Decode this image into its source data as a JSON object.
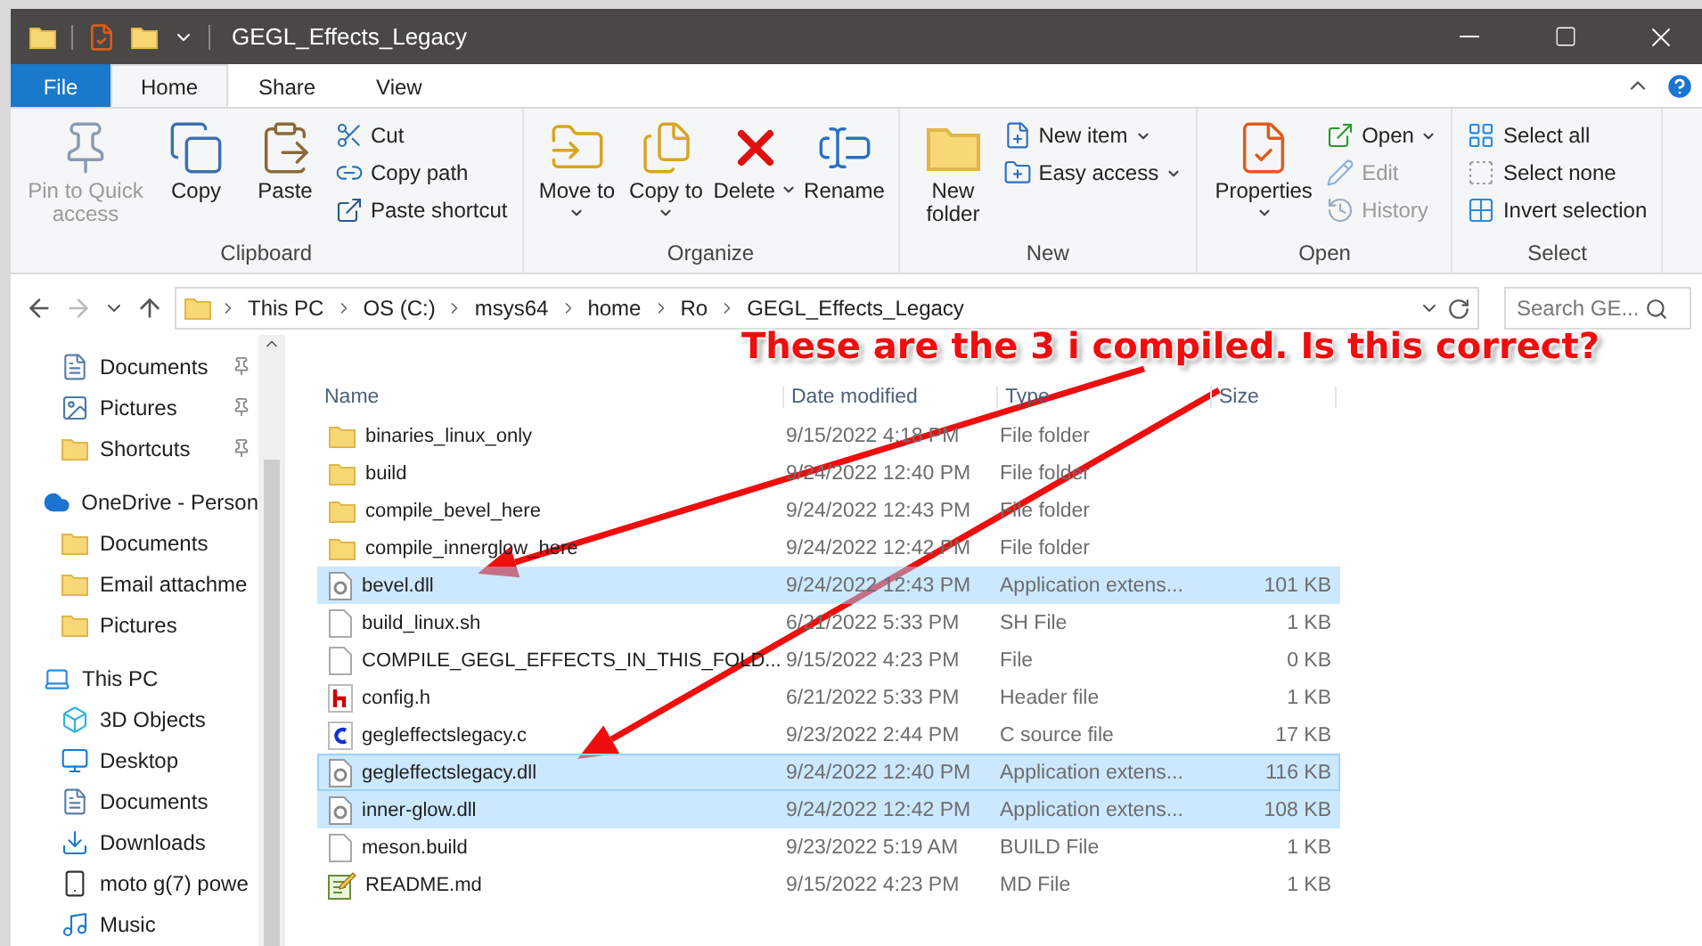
{
  "window": {
    "title": "GEGL_Effects_Legacy"
  },
  "ribbon_tabs": [
    {
      "label": "File",
      "kind": "file",
      "selected": false
    },
    {
      "label": "Home",
      "kind": "tab",
      "selected": true
    },
    {
      "label": "Share",
      "kind": "tab",
      "selected": false
    },
    {
      "label": "View",
      "kind": "tab",
      "selected": false
    }
  ],
  "ribbon": {
    "groups": [
      {
        "label": "Clipboard",
        "large": [
          {
            "label": "Pin to Quick access",
            "kind": "pin",
            "disabled": true,
            "dropdown": false
          },
          {
            "label": "Copy",
            "kind": "copy",
            "disabled": false,
            "dropdown": false
          },
          {
            "label": "Paste",
            "kind": "paste",
            "disabled": false,
            "dropdown": false
          }
        ],
        "small": [
          {
            "label": "Cut",
            "kind": "cut",
            "disabled": false,
            "dropdown": false
          },
          {
            "label": "Copy path",
            "kind": "path",
            "disabled": false,
            "dropdown": false
          },
          {
            "label": "Paste shortcut",
            "kind": "shortcut",
            "disabled": false,
            "dropdown": false
          }
        ]
      },
      {
        "label": "Organize",
        "large": [
          {
            "label": "Move to",
            "kind": "move",
            "disabled": false,
            "dropdown": true
          },
          {
            "label": "Copy to",
            "kind": "copyto",
            "disabled": false,
            "dropdown": true
          },
          {
            "label": "Delete",
            "kind": "delete",
            "disabled": false,
            "dropdown": true
          },
          {
            "label": "Rename",
            "kind": "rename",
            "disabled": false,
            "dropdown": false
          }
        ]
      },
      {
        "label": "New",
        "large": [
          {
            "label": "New folder",
            "kind": "folder",
            "disabled": false,
            "dropdown": false
          }
        ],
        "small": [
          {
            "label": "New item",
            "kind": "newitem",
            "disabled": false,
            "dropdown": true
          },
          {
            "label": "Easy access",
            "kind": "easy",
            "disabled": false,
            "dropdown": true
          }
        ]
      },
      {
        "label": "Open",
        "large": [
          {
            "label": "Properties",
            "kind": "properties",
            "disabled": false,
            "dropdown": true
          }
        ],
        "small": [
          {
            "label": "Open",
            "kind": "open",
            "disabled": false,
            "dropdown": true
          },
          {
            "label": "Edit",
            "kind": "edit",
            "disabled": true,
            "dropdown": false
          },
          {
            "label": "History",
            "kind": "history",
            "disabled": true,
            "dropdown": false
          }
        ]
      },
      {
        "label": "Select",
        "small": [
          {
            "label": "Select all",
            "kind": "selectall",
            "disabled": false,
            "dropdown": false
          },
          {
            "label": "Select none",
            "kind": "selectnone",
            "disabled": false,
            "dropdown": false
          },
          {
            "label": "Invert selection",
            "kind": "invert",
            "disabled": false,
            "dropdown": false
          }
        ]
      }
    ]
  },
  "address": {
    "crumbs": [
      "This PC",
      "OS (C:)",
      "msys64",
      "home",
      "Ro",
      "GEGL_Effects_Legacy"
    ],
    "search_placeholder": "Search GE..."
  },
  "sidebar": {
    "pinned": [
      {
        "label": "Documents",
        "kind": "documents"
      },
      {
        "label": "Pictures",
        "kind": "pictures"
      },
      {
        "label": "Shortcuts",
        "kind": "folder"
      }
    ],
    "tree": [
      {
        "label": "OneDrive - Person",
        "kind": "onedrive",
        "children": [
          {
            "label": "Documents",
            "kind": "folder"
          },
          {
            "label": "Email attachme",
            "kind": "folder"
          },
          {
            "label": "Pictures",
            "kind": "folder"
          }
        ]
      },
      {
        "label": "This PC",
        "kind": "pc",
        "children": [
          {
            "label": "3D Objects",
            "kind": "objects"
          },
          {
            "label": "Desktop",
            "kind": "desktop"
          },
          {
            "label": "Documents",
            "kind": "documents"
          },
          {
            "label": "Downloads",
            "kind": "downloads"
          },
          {
            "label": "moto g(7) powe",
            "kind": "phone"
          },
          {
            "label": "Music",
            "kind": "music"
          }
        ]
      }
    ]
  },
  "file_list": {
    "columns": [
      "Name",
      "Date modified",
      "Type",
      "Size"
    ],
    "rows": [
      {
        "name": "binaries_linux_only",
        "date": "9/15/2022 4:18 PM",
        "type": "File folder",
        "kind": "folder",
        "selected": false,
        "focused": false
      },
      {
        "name": "build",
        "date": "9/24/2022 12:40 PM",
        "type": "File folder",
        "kind": "folder",
        "selected": false,
        "focused": false
      },
      {
        "name": "compile_bevel_here",
        "date": "9/24/2022 12:43 PM",
        "type": "File folder",
        "kind": "folder",
        "selected": false,
        "focused": false
      },
      {
        "name": "compile_innerglow_here",
        "date": "9/24/2022 12:42 PM",
        "type": "File folder",
        "kind": "folder",
        "selected": false,
        "focused": false
      },
      {
        "name": "bevel.dll",
        "date": "9/24/2022 12:43 PM",
        "type": "Application extens...",
        "size": "101 KB",
        "kind": "dll",
        "selected": true,
        "focused": false
      },
      {
        "name": "build_linux.sh",
        "date": "6/21/2022 5:33 PM",
        "type": "SH File",
        "size": "1 KB",
        "kind": "file",
        "selected": false,
        "focused": false
      },
      {
        "name": "COMPILE_GEGL_EFFECTS_IN_THIS_FOLD...",
        "date": "9/15/2022 4:23 PM",
        "type": "File",
        "size": "0 KB",
        "kind": "file",
        "selected": false,
        "focused": false
      },
      {
        "name": "config.h",
        "date": "6/21/2022 5:33 PM",
        "type": "Header file",
        "size": "1 KB",
        "kind": "header",
        "selected": false,
        "focused": false
      },
      {
        "name": "gegleffectslegacy.c",
        "date": "9/23/2022 2:44 PM",
        "type": "C source file",
        "size": "17 KB",
        "kind": "csource",
        "selected": false,
        "focused": false
      },
      {
        "name": "gegleffectslegacy.dll",
        "date": "9/24/2022 12:40 PM",
        "type": "Application extens...",
        "size": "116 KB",
        "kind": "dll",
        "selected": true,
        "focused": true
      },
      {
        "name": "inner-glow.dll",
        "date": "9/24/2022 12:42 PM",
        "type": "Application extens...",
        "size": "108 KB",
        "kind": "dll",
        "selected": true,
        "focused": false
      },
      {
        "name": "meson.build",
        "date": "9/23/2022 5:19 AM",
        "type": "BUILD File",
        "size": "1 KB",
        "kind": "file",
        "selected": false,
        "focused": false
      },
      {
        "name": "README.md",
        "date": "9/15/2022 4:23 PM",
        "type": "MD File",
        "size": "1 KB",
        "kind": "notepad",
        "selected": false,
        "focused": false
      }
    ]
  },
  "annotation": {
    "text": "These are the 3 i compiled. Is this correct?"
  }
}
